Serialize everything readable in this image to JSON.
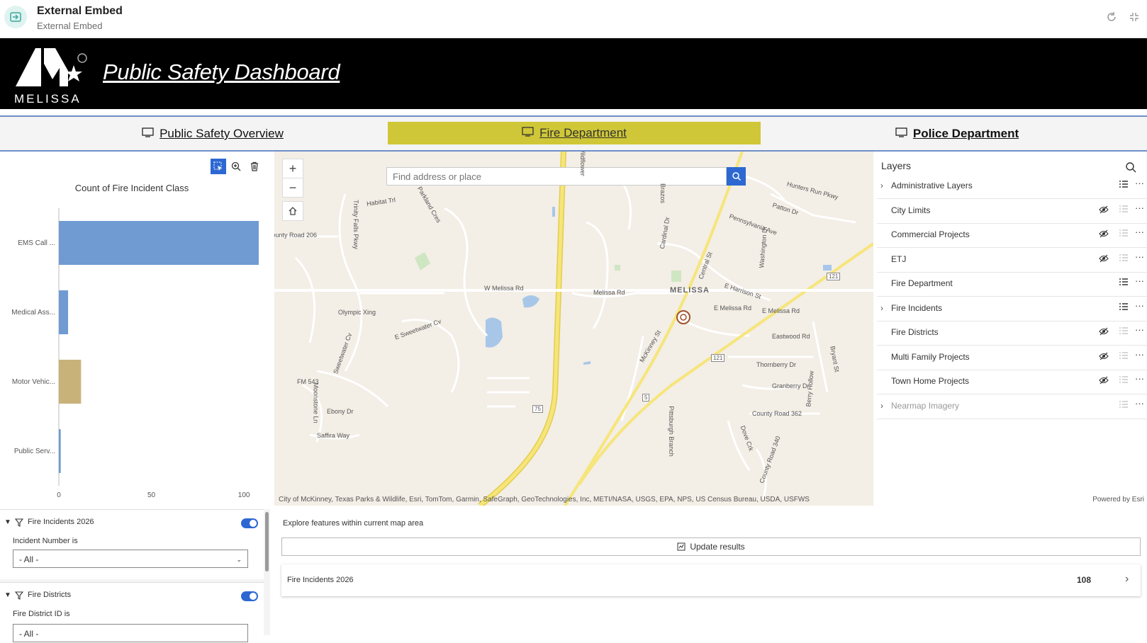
{
  "embed": {
    "title": "External Embed",
    "subtitle": "External Embed"
  },
  "header": {
    "logo_text": "MELISSA",
    "title": "Public Safety Dashboard"
  },
  "nav": {
    "tabs": [
      {
        "label": "Public Safety Overview",
        "active": false
      },
      {
        "label": "Fire Department",
        "active": true
      },
      {
        "label": "Police Department",
        "active": false
      }
    ],
    "active_color": "#cfc737"
  },
  "chart_data": {
    "type": "bar",
    "orientation": "horizontal",
    "title": "Count of Fire Incident Class",
    "categories": [
      "EMS Call ...",
      "Medical Ass...",
      "Motor Vehic...",
      "Public Serv..."
    ],
    "values": [
      108,
      5,
      12,
      1
    ],
    "colors": [
      "#6f9bd2",
      "#6f9bd2",
      "#c9b27a",
      "#6f9bd2"
    ],
    "xlim": [
      0,
      108
    ],
    "xticks": [
      0,
      50,
      100
    ],
    "grid": false
  },
  "map": {
    "search_placeholder": "Find address or place",
    "labels": [
      "Hunters Run Pkwy",
      "Patton Dr",
      "Pennsylvania Ave",
      "Parkland Cres",
      "Habitat Trl",
      "County Road 206",
      "Trinity Falls Pkwy",
      "W Melissa Rd",
      "Melissa Rd",
      "MELISSA",
      "E Harrison St",
      "E Melissa Rd",
      "E Melissa Rd",
      "Olympic Xing",
      "E Sweetwater Cv",
      "Sweetwater Cv",
      "Eastwood Rd",
      "Thornberry Dr",
      "Granberry Dr",
      "County Road 362",
      "FM 543",
      "Ebony Dr",
      "Saffira Way",
      "Moonstone Ln",
      "McKinney St",
      "Cardinal Dr",
      "Central St",
      "Washington Dr",
      "Brazos",
      "Dove Crk",
      "County Road 340",
      "Bryant St",
      "Berry Hollow",
      "Pittsburgh Branch",
      "Wildflower"
    ],
    "shields": [
      "75",
      "121",
      "121",
      "5"
    ],
    "attribution": "City of McKinney, Texas Parks & Wildlife, Esri, TomTom, Garmin, SafeGraph, GeoTechnologies, Inc, METI/NASA, USGS, EPA, NPS, US Census Bureau, USDA, USFWS",
    "zoom_in": "+",
    "zoom_out": "−"
  },
  "layers": {
    "title": "Layers",
    "items": [
      {
        "name": "Administrative Layers",
        "expandable": true,
        "visible": true,
        "legend": true,
        "dim": false
      },
      {
        "name": "City Limits",
        "expandable": false,
        "visible": false,
        "legend": false,
        "dim": false
      },
      {
        "name": "Commercial Projects",
        "expandable": false,
        "visible": false,
        "legend": false,
        "dim": false
      },
      {
        "name": "ETJ",
        "expandable": false,
        "visible": false,
        "legend": false,
        "dim": false
      },
      {
        "name": "Fire Department",
        "expandable": false,
        "visible": true,
        "legend": true,
        "dim": false
      },
      {
        "name": "Fire Incidents",
        "expandable": true,
        "visible": true,
        "legend": true,
        "dim": false
      },
      {
        "name": "Fire Districts",
        "expandable": false,
        "visible": false,
        "legend": false,
        "dim": false
      },
      {
        "name": "Multi Family Projects",
        "expandable": false,
        "visible": false,
        "legend": false,
        "dim": false
      },
      {
        "name": "Town Home Projects",
        "expandable": false,
        "visible": false,
        "legend": false,
        "dim": false
      },
      {
        "name": "Nearmap Imagery",
        "expandable": true,
        "visible": true,
        "legend": false,
        "dim": true
      }
    ],
    "powered_by": "Powered by Esri"
  },
  "filters": {
    "blocks": [
      {
        "title": "Fire Incidents 2026",
        "label": "Incident Number is",
        "value": "- All -",
        "enabled": true
      },
      {
        "title": "Fire Districts",
        "label": "Fire District ID is",
        "value": "- All -",
        "enabled": true
      }
    ]
  },
  "explore": {
    "heading": "Explore features within current map area",
    "update_label": "Update results",
    "results": [
      {
        "name": "Fire Incidents 2026",
        "count": "108"
      }
    ]
  }
}
